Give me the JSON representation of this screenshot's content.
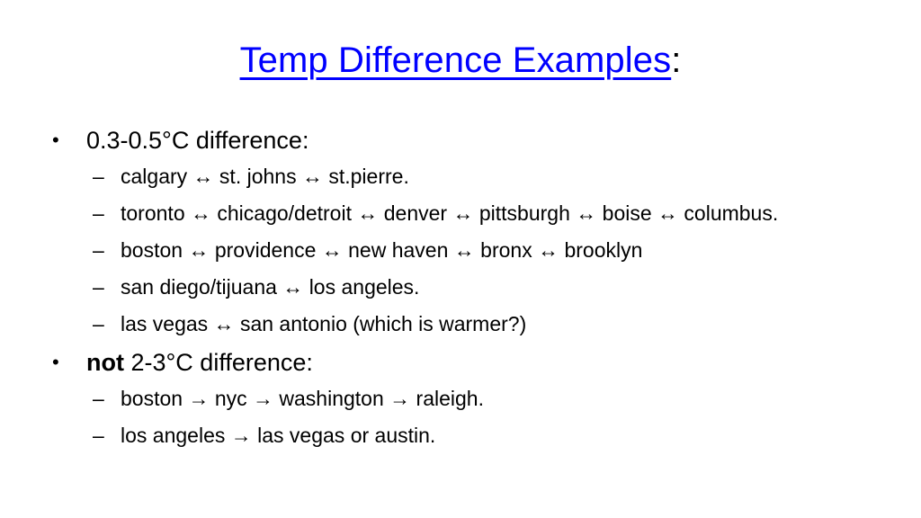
{
  "slide": {
    "background_color": "#ffffff",
    "title": {
      "underlined_text": "Temp Difference Examples",
      "trailing_punctuation": ":",
      "color": "#0000FF",
      "punctuation_color": "#000000"
    },
    "bullets": [
      {
        "level": 1,
        "marker": "•",
        "text": "0.3-0.5°C difference:",
        "bold_prefix": "",
        "children": [
          {
            "level": 2,
            "marker": "–",
            "text": "calgary ↔ st. johns ↔ st.pierre."
          },
          {
            "level": 2,
            "marker": "–",
            "text": "toronto ↔ chicago/detroit ↔ denver ↔ pittsburgh ↔ boise ↔ columbus."
          },
          {
            "level": 2,
            "marker": "–",
            "text": "boston ↔ providence ↔ new haven ↔ bronx ↔ brooklyn"
          },
          {
            "level": 2,
            "marker": "–",
            "text": "san diego/tijuana ↔ los angeles."
          },
          {
            "level": 2,
            "marker": "–",
            "text": "las vegas ↔ san antonio (which is warmer?)"
          }
        ]
      },
      {
        "level": 1,
        "marker": "•",
        "bold_prefix": "not",
        "text": " 2-3°C difference:",
        "children": [
          {
            "level": 2,
            "marker": "–",
            "text": "boston → nyc → washington → raleigh."
          },
          {
            "level": 2,
            "marker": "–",
            "text": "los angeles → las vegas or austin."
          }
        ]
      }
    ]
  }
}
